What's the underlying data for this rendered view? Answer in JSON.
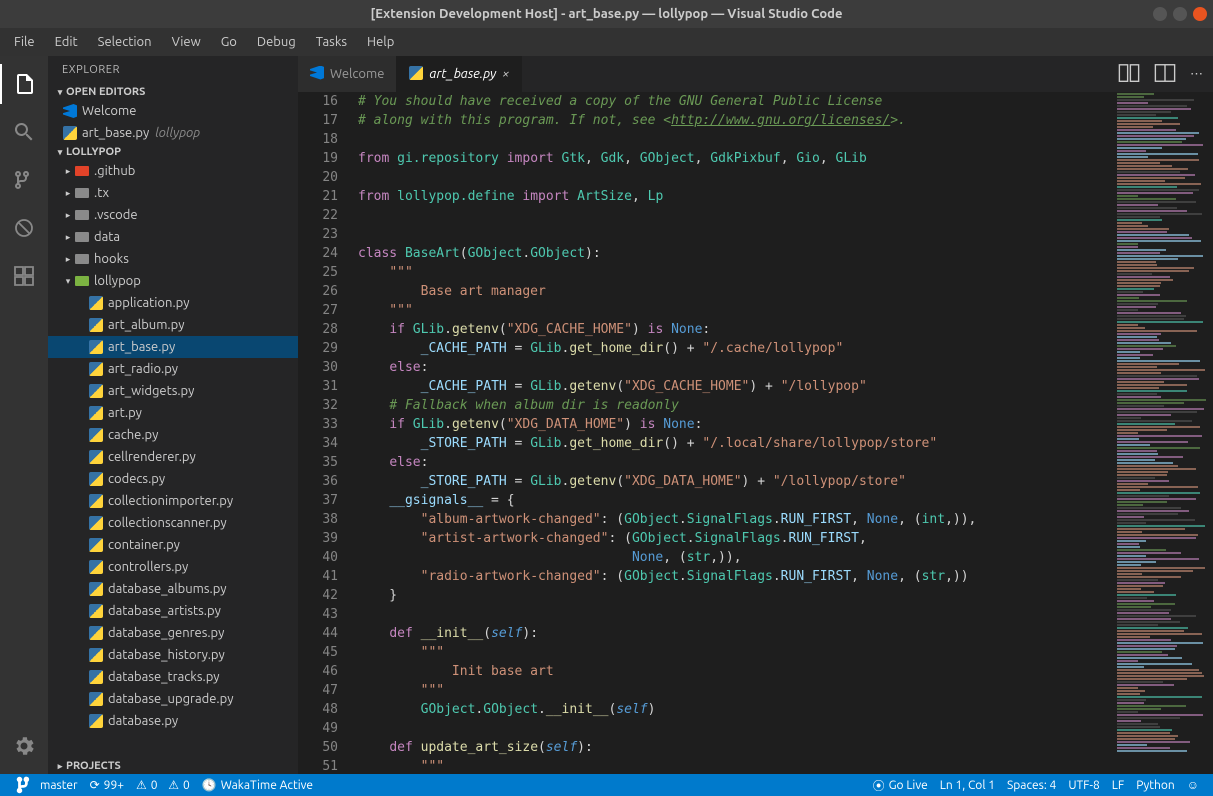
{
  "titlebar": {
    "title": "[Extension Development Host] - art_base.py — lollypop — Visual Studio Code"
  },
  "menubar": [
    "File",
    "Edit",
    "Selection",
    "View",
    "Go",
    "Debug",
    "Tasks",
    "Help"
  ],
  "sidebar": {
    "title": "EXPLORER",
    "sections": {
      "openEditors": "OPEN EDITORS",
      "workspace": "LOLLYPOP",
      "projects": "PROJECTS"
    },
    "openEditors": [
      {
        "label": "Welcome",
        "icon": "vs"
      },
      {
        "label": "art_base.py",
        "icon": "py",
        "desc": "lollypop"
      }
    ],
    "tree": [
      {
        "l": ".github",
        "t": "folder",
        "cls": "git",
        "i": 1,
        "chev": "▸"
      },
      {
        "l": ".tx",
        "t": "folder",
        "cls": "gray",
        "i": 1,
        "chev": "▸"
      },
      {
        "l": ".vscode",
        "t": "folder",
        "cls": "gray",
        "i": 1,
        "chev": "▸"
      },
      {
        "l": "data",
        "t": "folder",
        "cls": "gray",
        "i": 1,
        "chev": "▸"
      },
      {
        "l": "hooks",
        "t": "folder",
        "cls": "gray",
        "i": 1,
        "chev": "▸"
      },
      {
        "l": "lollypop",
        "t": "folder",
        "cls": "green",
        "i": 1,
        "chev": "▾"
      },
      {
        "l": "application.py",
        "t": "py",
        "i": 2
      },
      {
        "l": "art_album.py",
        "t": "py",
        "i": 2
      },
      {
        "l": "art_base.py",
        "t": "py",
        "i": 2,
        "selected": true
      },
      {
        "l": "art_radio.py",
        "t": "py",
        "i": 2
      },
      {
        "l": "art_widgets.py",
        "t": "py",
        "i": 2
      },
      {
        "l": "art.py",
        "t": "py",
        "i": 2
      },
      {
        "l": "cache.py",
        "t": "py",
        "i": 2
      },
      {
        "l": "cellrenderer.py",
        "t": "py",
        "i": 2
      },
      {
        "l": "codecs.py",
        "t": "py",
        "i": 2
      },
      {
        "l": "collectionimporter.py",
        "t": "py",
        "i": 2
      },
      {
        "l": "collectionscanner.py",
        "t": "py",
        "i": 2
      },
      {
        "l": "container.py",
        "t": "py",
        "i": 2
      },
      {
        "l": "controllers.py",
        "t": "py",
        "i": 2
      },
      {
        "l": "database_albums.py",
        "t": "py",
        "i": 2
      },
      {
        "l": "database_artists.py",
        "t": "py",
        "i": 2
      },
      {
        "l": "database_genres.py",
        "t": "py",
        "i": 2
      },
      {
        "l": "database_history.py",
        "t": "py",
        "i": 2
      },
      {
        "l": "database_tracks.py",
        "t": "py",
        "i": 2
      },
      {
        "l": "database_upgrade.py",
        "t": "py",
        "i": 2
      },
      {
        "l": "database.py",
        "t": "py",
        "i": 2
      }
    ]
  },
  "tabs": [
    {
      "label": "Welcome",
      "icon": "vs"
    },
    {
      "label": "art_base.py",
      "icon": "py",
      "active": true
    }
  ],
  "editor": {
    "startLine": 16,
    "lines": [
      {
        "n": 16,
        "h": "<span class='tok-com'># You should have received a copy of the GNU General Public License</span>"
      },
      {
        "n": 17,
        "h": "<span class='tok-com'># along with this program. If not, see &lt;</span><span class='tok-link'>http://www.gnu.org/licenses/</span><span class='tok-com'>&gt;.</span>"
      },
      {
        "n": 18,
        "h": ""
      },
      {
        "n": 19,
        "h": "<span class='tok-kw'>from</span> <span class='tok-type'>gi.repository</span> <span class='tok-kw'>import</span> <span class='tok-type'>Gtk</span>, <span class='tok-type'>Gdk</span>, <span class='tok-type'>GObject</span>, <span class='tok-type'>GdkPixbuf</span>, <span class='tok-type'>Gio</span>, <span class='tok-type'>GLib</span>"
      },
      {
        "n": 20,
        "h": ""
      },
      {
        "n": 21,
        "h": "<span class='tok-kw'>from</span> <span class='tok-type'>lollypop.define</span> <span class='tok-kw'>import</span> <span class='tok-type'>ArtSize</span>, <span class='tok-type'>Lp</span>"
      },
      {
        "n": 22,
        "h": ""
      },
      {
        "n": 23,
        "h": ""
      },
      {
        "n": 24,
        "h": "<span class='tok-kw'>class</span> <span class='tok-cls'>BaseArt</span>(<span class='tok-type'>GObject</span>.<span class='tok-type'>GObject</span>):"
      },
      {
        "n": 25,
        "h": "    <span class='tok-str'>\"\"\"</span>"
      },
      {
        "n": 26,
        "h": "<span class='tok-str'>        Base art manager</span>"
      },
      {
        "n": 27,
        "h": "<span class='tok-str'>    \"\"\"</span>"
      },
      {
        "n": 28,
        "h": "    <span class='tok-kw'>if</span> <span class='tok-type'>GLib</span>.<span class='tok-fn'>getenv</span>(<span class='tok-str'>\"XDG_CACHE_HOME\"</span>) <span class='tok-kw'>is</span> <span class='tok-const'>None</span>:"
      },
      {
        "n": 29,
        "h": "        <span class='tok-var'>_CACHE_PATH</span> = <span class='tok-type'>GLib</span>.<span class='tok-fn'>get_home_dir</span>() + <span class='tok-str'>\"/.cache/lollypop\"</span>"
      },
      {
        "n": 30,
        "h": "    <span class='tok-kw'>else</span>:"
      },
      {
        "n": 31,
        "h": "        <span class='tok-var'>_CACHE_PATH</span> = <span class='tok-type'>GLib</span>.<span class='tok-fn'>getenv</span>(<span class='tok-str'>\"XDG_CACHE_HOME\"</span>) + <span class='tok-str'>\"/lollypop\"</span>"
      },
      {
        "n": 32,
        "h": "    <span class='tok-com'># Fallback when album dir is readonly</span>"
      },
      {
        "n": 33,
        "h": "    <span class='tok-kw'>if</span> <span class='tok-type'>GLib</span>.<span class='tok-fn'>getenv</span>(<span class='tok-str'>\"XDG_DATA_HOME\"</span>) <span class='tok-kw'>is</span> <span class='tok-const'>None</span>:"
      },
      {
        "n": 34,
        "h": "        <span class='tok-var'>_STORE_PATH</span> = <span class='tok-type'>GLib</span>.<span class='tok-fn'>get_home_dir</span>() + <span class='tok-str'>\"/.local/share/lollypop/store\"</span>"
      },
      {
        "n": 35,
        "h": "    <span class='tok-kw'>else</span>:"
      },
      {
        "n": 36,
        "h": "        <span class='tok-var'>_STORE_PATH</span> = <span class='tok-type'>GLib</span>.<span class='tok-fn'>getenv</span>(<span class='tok-str'>\"XDG_DATA_HOME\"</span>) + <span class='tok-str'>\"/lollypop/store\"</span>"
      },
      {
        "n": 37,
        "h": "    <span class='tok-var'>__gsignals__</span> = {"
      },
      {
        "n": 38,
        "h": "        <span class='tok-str'>\"album-artwork-changed\"</span>: (<span class='tok-type'>GObject</span>.<span class='tok-type'>SignalFlags</span>.<span class='tok-var'>RUN_FIRST</span>, <span class='tok-const'>None</span>, (<span class='tok-type'>int</span>,)),",
        "cursor": true
      },
      {
        "n": 39,
        "h": "        <span class='tok-str'>\"artist-artwork-changed\"</span>: (<span class='tok-type'>GObject</span>.<span class='tok-type'>SignalFlags</span>.<span class='tok-var'>RUN_FIRST</span>,"
      },
      {
        "n": 40,
        "h": "                                   <span class='tok-const'>None</span>, (<span class='tok-type'>str</span>,)),"
      },
      {
        "n": 41,
        "h": "        <span class='tok-str'>\"radio-artwork-changed\"</span>: (<span class='tok-type'>GObject</span>.<span class='tok-type'>SignalFlags</span>.<span class='tok-var'>RUN_FIRST</span>, <span class='tok-const'>None</span>, (<span class='tok-type'>str</span>,))"
      },
      {
        "n": 42,
        "h": "    }"
      },
      {
        "n": 43,
        "h": ""
      },
      {
        "n": 44,
        "h": "    <span class='tok-kw'>def</span> <span class='tok-fn'>__init__</span>(<span class='tok-self'>self</span>):"
      },
      {
        "n": 45,
        "h": "        <span class='tok-str'>\"\"\"</span>"
      },
      {
        "n": 46,
        "h": "<span class='tok-str'>            Init base art</span>"
      },
      {
        "n": 47,
        "h": "<span class='tok-str'>        \"\"\"</span>"
      },
      {
        "n": 48,
        "h": "        <span class='tok-type'>GObject</span>.<span class='tok-type'>GObject</span>.<span class='tok-fn'>__init__</span>(<span class='tok-self'>self</span>)"
      },
      {
        "n": 49,
        "h": ""
      },
      {
        "n": 50,
        "h": "    <span class='tok-kw'>def</span> <span class='tok-fn'>update_art_size</span>(<span class='tok-self'>self</span>):"
      },
      {
        "n": 51,
        "h": "        <span class='tok-str'>\"\"\"</span>"
      }
    ]
  },
  "statusbar": {
    "branch": "master",
    "sync": "99+",
    "errors": "0",
    "warnings": "0",
    "wakatime": "WakaTime Active",
    "golive": "Go Live",
    "cursor": "Ln 1, Col 1",
    "spaces": "Spaces: 4",
    "encoding": "UTF-8",
    "eol": "LF",
    "lang": "Python"
  }
}
